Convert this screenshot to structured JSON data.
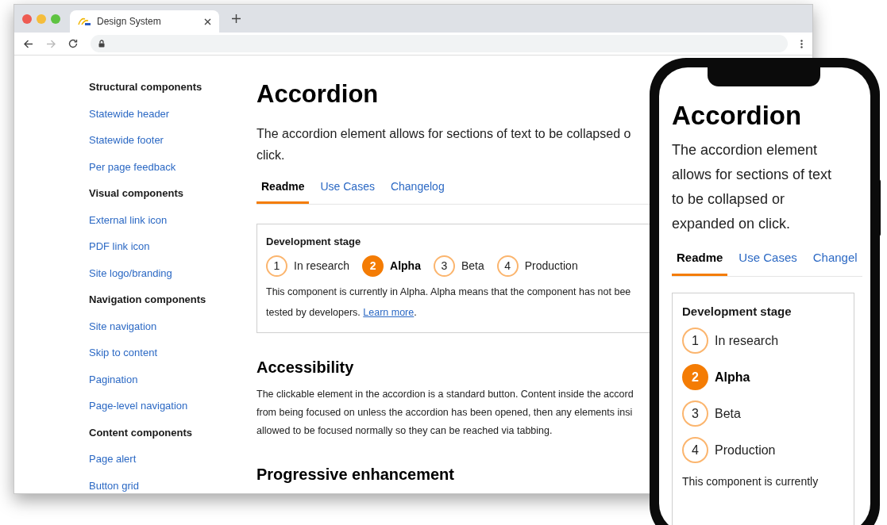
{
  "browser": {
    "tab": {
      "title": "Design System"
    },
    "sidebar": [
      {
        "heading": "Structural components",
        "items": [
          "Statewide header",
          "Statewide footer",
          "Per page feedback"
        ]
      },
      {
        "heading": "Visual components",
        "items": [
          "External link icon",
          "PDF link icon",
          "Site logo/branding"
        ]
      },
      {
        "heading": "Navigation components",
        "items": [
          "Site navigation",
          "Skip to content",
          "Pagination",
          "Page-level navigation"
        ]
      },
      {
        "heading": "Content components",
        "items": [
          "Page alert",
          "Button grid"
        ]
      }
    ],
    "page": {
      "title": "Accordion",
      "intro_lines": [
        "The accordion element allows for sections of text to be collapsed o",
        "click."
      ],
      "tabs": [
        {
          "label": "Readme",
          "selected": true
        },
        {
          "label": "Use Cases",
          "selected": false
        },
        {
          "label": "Changelog",
          "selected": false
        }
      ],
      "stage": {
        "heading": "Development stage",
        "steps": [
          {
            "number": "1",
            "label": "In research",
            "selected": false
          },
          {
            "number": "2",
            "label": "Alpha",
            "selected": true
          },
          {
            "number": "3",
            "label": "Beta",
            "selected": false
          },
          {
            "number": "4",
            "label": "Production",
            "selected": false
          }
        ],
        "text_lines": [
          "This component is currently in Alpha. Alpha means that the component has not bee",
          "tested by developers. "
        ],
        "link": "Learn more",
        "after_link": "."
      },
      "sections": [
        {
          "heading": "Accessibility",
          "lines": [
            "The clickable element in the accordion is a standard button. Content inside the accord",
            "from being focused on unless the accordion has been opened, then any elements insi",
            "allowed to be focused normally so they can be reached via tabbing."
          ]
        },
        {
          "heading": "Progressive enhancement"
        }
      ]
    }
  },
  "phone": {
    "title": "Accordion",
    "intro_lines": [
      "The accordion element",
      "allows for sections of text",
      "to be collapsed or",
      "expanded on click."
    ],
    "tabs": [
      {
        "label": "Readme",
        "selected": true
      },
      {
        "label": "Use Cases",
        "selected": false
      },
      {
        "label": "Changel",
        "selected": false
      }
    ],
    "stage": {
      "heading": "Development stage",
      "steps": [
        {
          "number": "1",
          "label": "In research",
          "selected": false
        },
        {
          "number": "2",
          "label": "Alpha",
          "selected": true
        },
        {
          "number": "3",
          "label": "Beta",
          "selected": false
        },
        {
          "number": "4",
          "label": "Production",
          "selected": false
        }
      ],
      "text": "This component is currently"
    }
  }
}
